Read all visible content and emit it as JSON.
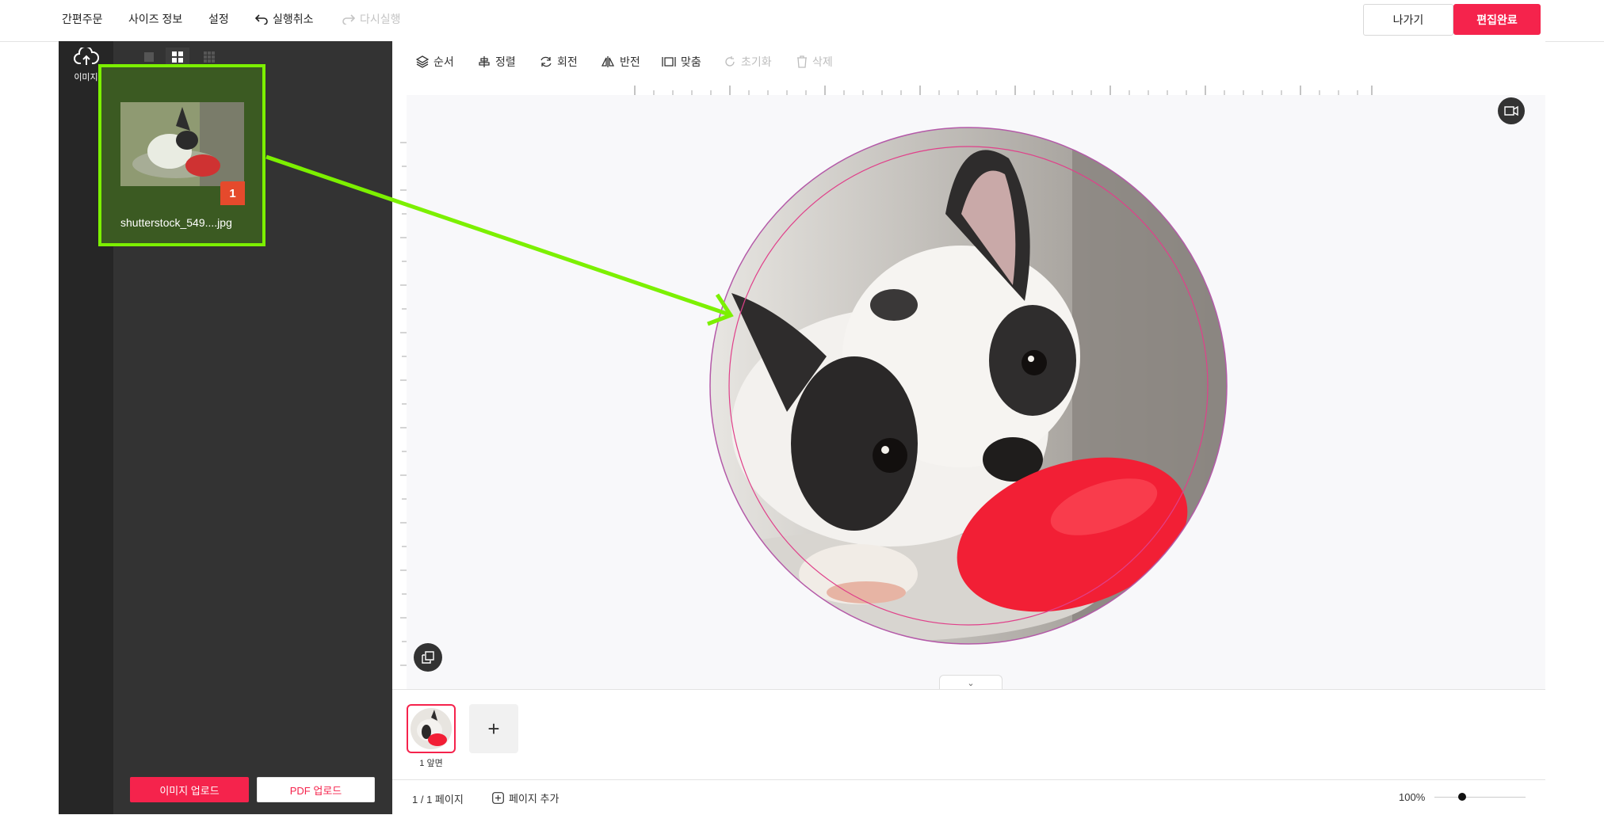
{
  "topbar": {
    "menu": [
      "간편주문",
      "사이즈 정보",
      "설정"
    ],
    "undo": "실행취소",
    "redo": "다시실행",
    "exit": "나가기",
    "done": "편집완료"
  },
  "sidebar": {
    "upload_label": "이미지",
    "view_modes": [
      "single-view-icon",
      "grid-2-icon",
      "grid-3-icon"
    ],
    "images": [
      {
        "name": "shutterstock_549....jpg",
        "usage_count": "1"
      }
    ],
    "upload_image": "이미지 업로드",
    "upload_pdf": "PDF 업로드"
  },
  "toolbar": {
    "order": "순서",
    "align": "정렬",
    "rotate": "회전",
    "flip": "반전",
    "fit": "맞춤",
    "reset": "초기화",
    "delete": "삭제"
  },
  "pages": {
    "thumb_label": "1 앞면",
    "add_icon": "+"
  },
  "status": {
    "page_indicator": "1 / 1 페이지",
    "add_page": "페이지 추가",
    "zoom": "100%",
    "zoom_level": 0.3
  },
  "colors": {
    "accent": "#f5234c",
    "highlight": "#7cf000",
    "panel": "#333333"
  }
}
